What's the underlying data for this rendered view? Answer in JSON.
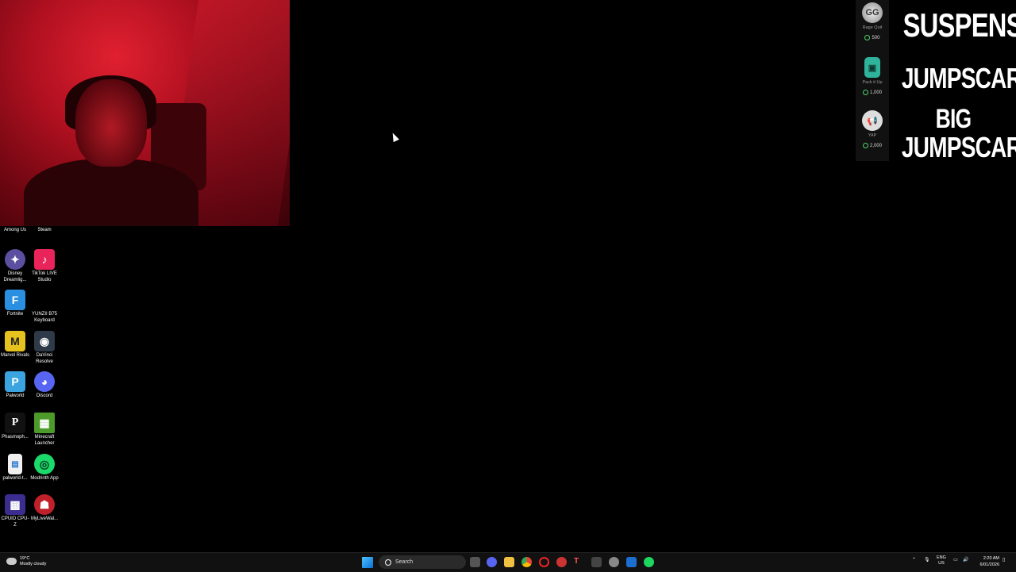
{
  "overlay": {
    "rewards": [
      {
        "name": "Rage Quit",
        "cost": "500",
        "icon": "gg-badge-icon"
      },
      {
        "name": "Pack it Up",
        "cost": "1,000",
        "icon": "suitcase-icon"
      },
      {
        "name": "YAP",
        "cost": "2,000",
        "icon": "megaphone-icon"
      }
    ],
    "labels": [
      "SUSPENSE",
      "JUMPSCARE",
      "BIG",
      "JUMPSCARE"
    ],
    "gg_text": "GG"
  },
  "desktop": {
    "icons": [
      {
        "label": "Among Us",
        "icon": "among-us-icon",
        "color": "#3b4a7a"
      },
      {
        "label": "Steam",
        "icon": "steam-icon",
        "color": "#1b2838"
      },
      {
        "label": "Disney Dreamlig...",
        "icon": "disney-dreamlight-icon",
        "color": "#5b4fa0"
      },
      {
        "label": "TikTok LIVE Studio",
        "icon": "tiktok-icon",
        "color": "#e9245a"
      },
      {
        "label": "Fortnite",
        "icon": "fortnite-icon",
        "color": "#2a8fe0"
      },
      {
        "label": "YUNZII B75 Keyboard",
        "icon": "keyboard-icon",
        "color": "#000000"
      },
      {
        "label": "Marvel Rivals",
        "icon": "marvel-rivals-icon",
        "color": "#e6c21e"
      },
      {
        "label": "DaVinci Resolve",
        "icon": "davinci-resolve-icon",
        "color": "#2e3a48"
      },
      {
        "label": "Palworld",
        "icon": "palworld-icon",
        "color": "#3aa3e0"
      },
      {
        "label": "Discord",
        "icon": "discord-icon",
        "color": "#5865f2"
      },
      {
        "label": "Phasmoph...",
        "icon": "phasmophobia-icon",
        "color": "#111111"
      },
      {
        "label": "Minecraft Launcher",
        "icon": "minecraft-icon",
        "color": "#4c9a2a"
      },
      {
        "label": "palworld-t...",
        "icon": "file-icon",
        "color": "#f0f0f0"
      },
      {
        "label": "Modrinth App",
        "icon": "modrinth-icon",
        "color": "#1bd96a"
      },
      {
        "label": "CPUID CPU-Z",
        "icon": "cpuz-icon",
        "color": "#3a2d8f"
      },
      {
        "label": "MyLiveWal...",
        "icon": "mylivewallpaper-icon",
        "color": "#c0202a"
      }
    ]
  },
  "taskbar": {
    "weather_temp": "19°C",
    "weather_desc": "Mostly cloudy",
    "search_label": "Search",
    "lang_top": "ENG",
    "lang_bottom": "US",
    "time": "2:20 AM",
    "date": "6/01/2026"
  }
}
